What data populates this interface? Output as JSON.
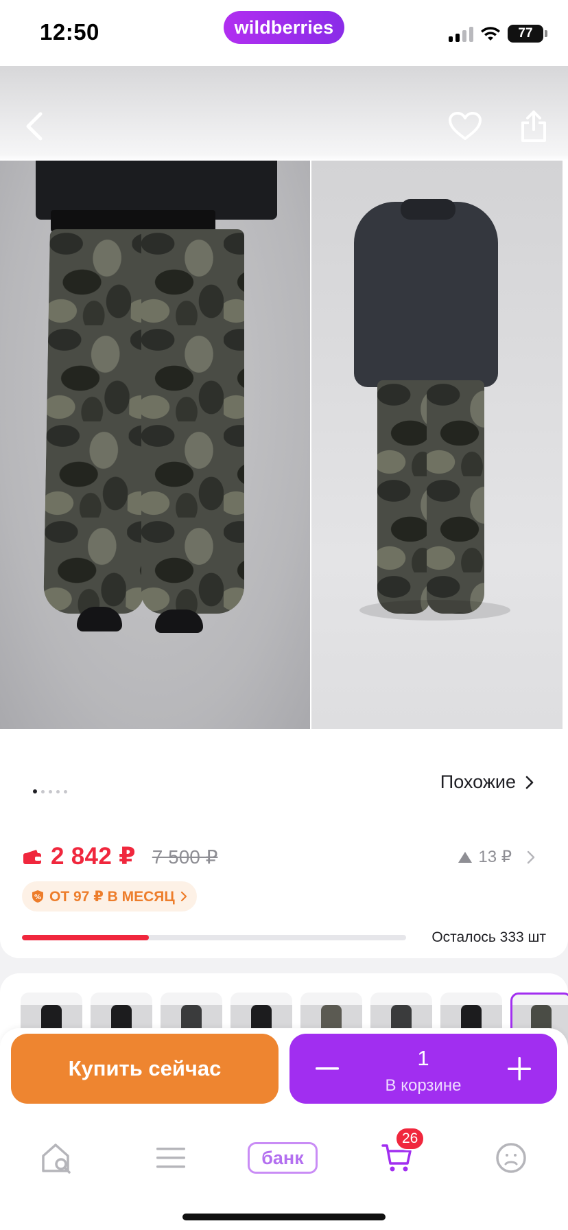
{
  "status_bar": {
    "time": "12:50",
    "brand": "wildberries",
    "battery": "77",
    "icons": [
      "signal-icon",
      "wifi-icon",
      "battery-icon"
    ]
  },
  "nav": {
    "icons": [
      "back-arrow-icon",
      "heart-icon",
      "share-icon"
    ]
  },
  "gallery": {
    "images": [
      "front-view-camo-pants",
      "back-view-camo-pants"
    ],
    "page_count": 5,
    "current_page": 1,
    "similar_label": "Похожие"
  },
  "price": {
    "current": "2 842 ₽",
    "old": "7 500 ₽",
    "change": "13 ₽",
    "installment": "ОТ 97 ₽ В МЕСЯЦ",
    "accent_color": "#f0273d"
  },
  "stock": {
    "remaining_label": "Осталось 333 шт",
    "fill_fraction": 0.33
  },
  "variants": {
    "count": 8,
    "selected_index": 7
  },
  "actions": {
    "buy_now": "Купить сейчас",
    "quantity": "1",
    "in_cart": "В корзине",
    "buy_color": "#ee8530",
    "cart_color": "#a12ef0"
  },
  "tab_bar": {
    "bank_label": "банк",
    "cart_badge": "26",
    "icons": [
      "home-search-icon",
      "menu-icon",
      "bank-icon",
      "cart-icon",
      "profile-icon"
    ]
  }
}
